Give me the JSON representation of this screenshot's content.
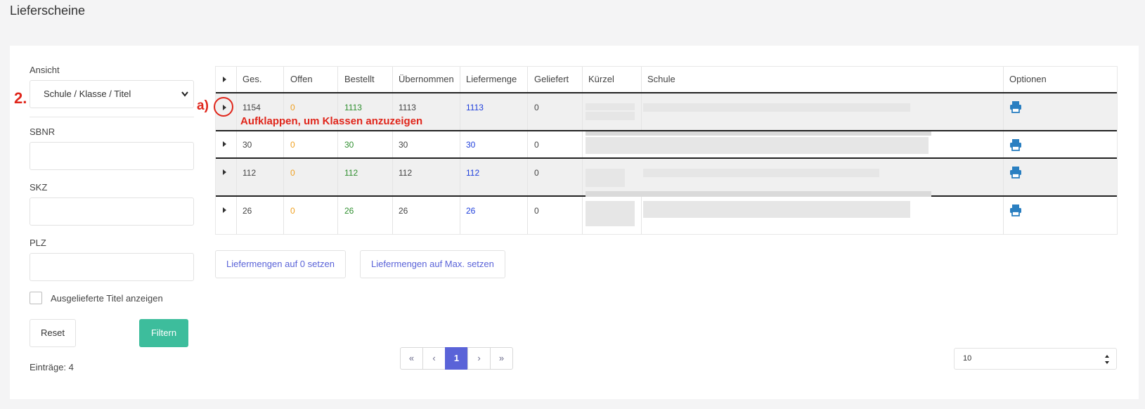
{
  "page": {
    "title": "Lieferscheine"
  },
  "sidebar": {
    "ansicht_label": "Ansicht",
    "ansicht_value": "Schule / Klasse / Titel",
    "sbnr_label": "SBNR",
    "skz_label": "SKZ",
    "plz_label": "PLZ",
    "checkbox_label": "Ausgelieferte Titel anzeigen",
    "reset_label": "Reset",
    "filter_label": "Filtern",
    "entries_text": "Einträge: 4"
  },
  "annotations": {
    "step": "2.",
    "a_label": "a)",
    "expand_hint": "Aufklappen, um Klassen anzuzeigen"
  },
  "table": {
    "columns": [
      "Ges.",
      "Offen",
      "Bestellt",
      "Übernommen",
      "Liefermenge",
      "Geliefert",
      "Kürzel",
      "Schule",
      "Optionen"
    ],
    "rows": [
      {
        "ges": "1154",
        "offen": "0",
        "bestellt": "1113",
        "uebernommen": "1113",
        "liefermenge": "1113",
        "geliefert": "0"
      },
      {
        "ges": "30",
        "offen": "0",
        "bestellt": "30",
        "uebernommen": "30",
        "liefermenge": "30",
        "geliefert": "0"
      },
      {
        "ges": "112",
        "offen": "0",
        "bestellt": "112",
        "uebernommen": "112",
        "liefermenge": "112",
        "geliefert": "0"
      },
      {
        "ges": "26",
        "offen": "0",
        "bestellt": "26",
        "uebernommen": "26",
        "liefermenge": "26",
        "geliefert": "0"
      }
    ]
  },
  "actions": {
    "set_zero": "Liefermengen auf 0 setzen",
    "set_max": "Liefermengen auf Max. setzen"
  },
  "pagination": {
    "first": "«",
    "prev": "‹",
    "current": "1",
    "next": "›",
    "last": "»",
    "page_size": "10"
  },
  "colors": {
    "accent": "#5a63d8",
    "filter_button": "#3dbd9c",
    "annotation": "#e0261b",
    "offen": "#f0a020",
    "bestellt": "#2f8f2f",
    "liefermenge": "#1f3fdc"
  },
  "icons": [
    "caret-right-icon",
    "printer-icon",
    "chevron-down-icon",
    "sort-updown-icon"
  ]
}
